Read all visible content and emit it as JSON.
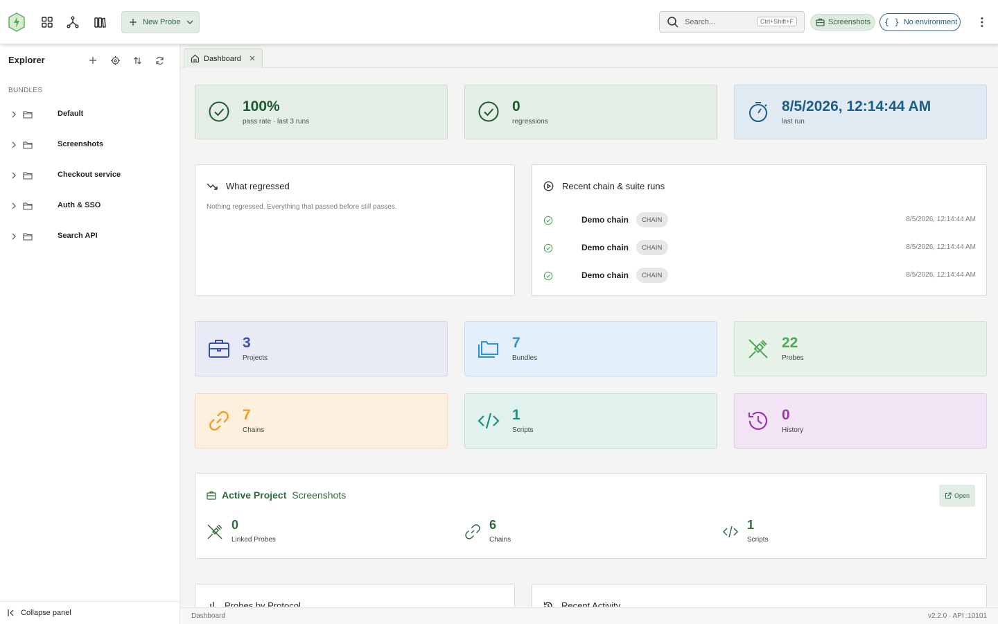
{
  "topbar": {
    "new_probe_label": "New Probe",
    "search_placeholder": "Search...",
    "search_shortcut": "Ctrl+Shift+F",
    "project_chip": "Screenshots",
    "env_chip": "No environment"
  },
  "sidebar": {
    "title": "Explorer",
    "section": "BUNDLES",
    "items": [
      {
        "label": "Default"
      },
      {
        "label": "Screenshots"
      },
      {
        "label": "Checkout service"
      },
      {
        "label": "Auth & SSO"
      },
      {
        "label": "Search API"
      }
    ],
    "collapse_label": "Collapse panel"
  },
  "tabs": [
    {
      "label": "Dashboard"
    }
  ],
  "kpis": [
    {
      "value": "100%",
      "label": "pass rate · last 3 runs",
      "color": "#1e5a2e"
    },
    {
      "value": "0",
      "label": "regressions",
      "color": "#1e5a2e"
    },
    {
      "value": "8/5/2026, 12:14:44 AM",
      "label": "last run",
      "color": "#1f5e84"
    }
  ],
  "regressed": {
    "title": "What regressed",
    "empty": "Nothing regressed. Everything that passed before still passes."
  },
  "recent_runs": {
    "title": "Recent chain & suite runs",
    "rows": [
      {
        "name": "Demo chain",
        "badge": "CHAIN",
        "time": "8/5/2026, 12:14:44 AM"
      },
      {
        "name": "Demo chain",
        "badge": "CHAIN",
        "time": "8/5/2026, 12:14:44 AM"
      },
      {
        "name": "Demo chain",
        "badge": "CHAIN",
        "time": "8/5/2026, 12:14:44 AM"
      }
    ]
  },
  "stats": [
    {
      "value": "3",
      "label": "Projects",
      "icon": "briefcase-icon",
      "color": "#3e4fa8",
      "bg": "#e8eaf5"
    },
    {
      "value": "7",
      "label": "Bundles",
      "icon": "folders-icon",
      "color": "#2f8fd6",
      "bg": "#e3f0fb"
    },
    {
      "value": "22",
      "label": "Probes",
      "icon": "plug-off-icon",
      "color": "#4caa55",
      "bg": "#e7f2e8"
    },
    {
      "value": "7",
      "label": "Chains",
      "icon": "link-icon",
      "color": "#f29a1c",
      "bg": "#fdf0de"
    },
    {
      "value": "1",
      "label": "Scripts",
      "icon": "code-icon",
      "color": "#1a8f7f",
      "bg": "#e1f1ee"
    },
    {
      "value": "0",
      "label": "History",
      "icon": "history-icon",
      "color": "#9a35ab",
      "bg": "#f2e4f4"
    }
  ],
  "active_project": {
    "key": "Active Project",
    "name": "Screenshots",
    "open_label": "Open",
    "stats": [
      {
        "value": "0",
        "label": "Linked Probes",
        "icon": "plug-off-icon"
      },
      {
        "value": "6",
        "label": "Chains",
        "icon": "link-icon"
      },
      {
        "value": "1",
        "label": "Scripts",
        "icon": "code-icon"
      }
    ]
  },
  "lower_panels": {
    "protocol_title": "Probes by Protocol",
    "activity_title": "Recent Activity"
  },
  "footer": {
    "left": "Dashboard",
    "right": "v2.2.0 · API :10101"
  }
}
